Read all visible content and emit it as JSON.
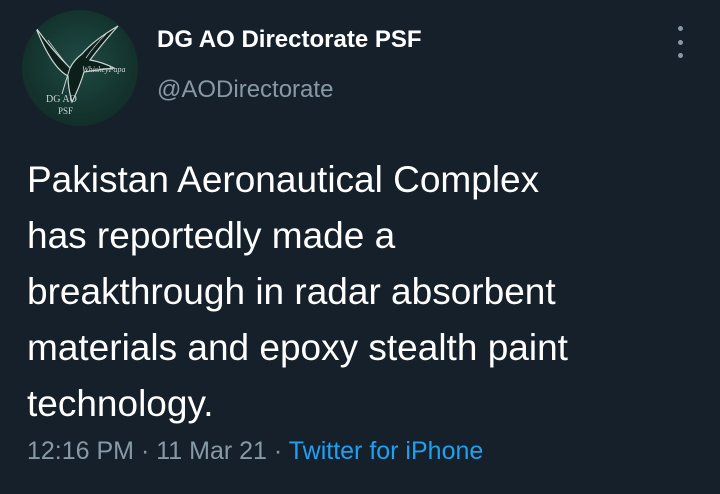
{
  "tweet": {
    "author": {
      "display_name": "DG AO Directorate PSF",
      "handle": "@AODirectorate",
      "avatar_text": {
        "watermark": "WhiskeyPapa",
        "line1": "DG AO",
        "line2": "PSF"
      }
    },
    "menu_icon": "more-vertical-icon",
    "text_lines": [
      "Pakistan Aeronautical Complex",
      "has reportedly made a",
      "breakthrough in radar absorbent",
      "materials and epoxy stealth paint",
      "technology."
    ],
    "time": "12:16 PM",
    "separator": "·",
    "date": "11 Mar 21",
    "source": "Twitter for iPhone"
  },
  "colors": {
    "background": "#15202b",
    "text_primary": "#ffffff",
    "text_secondary": "#8899a6",
    "link": "#1da1f2"
  }
}
